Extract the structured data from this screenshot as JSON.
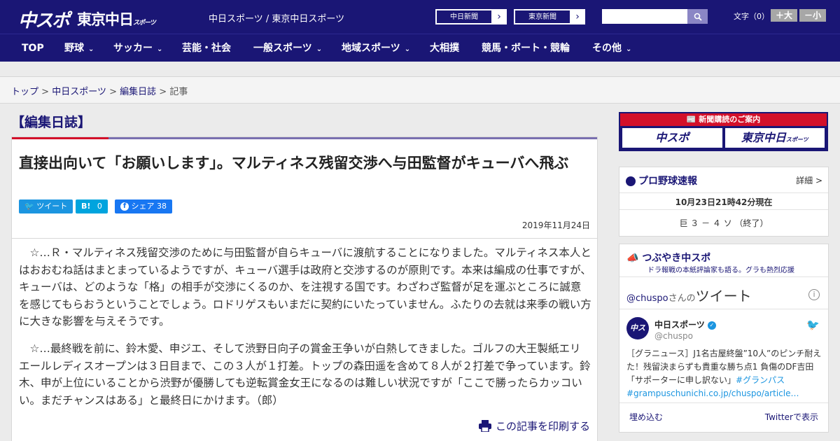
{
  "header": {
    "logo_chuspo": "中スポ",
    "logo_tokyo": "東京中日",
    "logo_tokyo_sub": "スポーツ",
    "site_title": "中日スポーツ / 東京中日スポーツ",
    "links": [
      {
        "label": "中日新聞",
        "arrow": "›"
      },
      {
        "label": "東京新聞",
        "arrow": "›"
      }
    ],
    "search_placeholder": "",
    "font_label": "文字（0）",
    "font_bigger": "＋大",
    "font_smaller": "－小"
  },
  "nav": {
    "items": [
      {
        "label": "TOP",
        "chevron": ""
      },
      {
        "label": "野球",
        "chevron": "⌄"
      },
      {
        "label": "サッカー",
        "chevron": "⌄"
      },
      {
        "label": "芸能・社会",
        "chevron": ""
      },
      {
        "label": "一般スポーツ",
        "chevron": "⌄"
      },
      {
        "label": "地域スポーツ",
        "chevron": "⌄"
      },
      {
        "label": "大相撲",
        "chevron": ""
      },
      {
        "label": "競馬・ボート・競輪",
        "chevron": ""
      },
      {
        "label": "その他",
        "chevron": "⌄"
      }
    ]
  },
  "breadcrumb": {
    "items": [
      "トップ",
      "中日スポーツ",
      "編集日誌"
    ],
    "separator": ">",
    "current": "記事"
  },
  "article": {
    "section": "【編集日誌】",
    "headline": "直接出向いて「お願いします」。マルティネス残留交渉へ与田監督がキューバへ飛ぶ",
    "share": {
      "tweet": "ツイート",
      "hatena": "B!",
      "hatena_count": "0",
      "facebook": "シェア",
      "facebook_count": "38"
    },
    "date": "2019年11月24日",
    "paragraphs": [
      "☆…Ｒ・マルティネス残留交渉のために与田監督が自らキューバに渡航することになりました。マルティネス本人とはおおむね話はまとまっているようですが、キューバ選手は政府と交渉するのが原則です。本来は編成の仕事ですが、キューバは、どのような「格」の相手が交渉にくるのか、を注視する国です。わざわざ監督が足を運ぶところに誠意を感じてもらおうということでしょう。ロドリゲスもいまだに契約にいたっていません。ふたりの去就は来季の戦い方に大きな影響を与えそうです。",
      "☆…最終戦を前に、鈴木愛、申ジエ、そして渋野日向子の賞金王争いが白熱してきました。ゴルフの大王製紙エリエールレディスオープンは３日目まで、この３人が１打差。トップの森田遥を含めて８人が２打差で争っています。鈴木、申が上位にいることから渋野が優勝しても逆転賞金女王になるのは難しい状況ですが「ここで勝ったらカッコいい。まだチャンスはある」と最終日にかけます。（郎）"
    ],
    "print_label": "この記事を印刷する"
  },
  "sidebar": {
    "subscribe": {
      "title": "新聞購読のご案内",
      "logo1": "中スポ",
      "logo2": "東京中日",
      "logo2_sub": "スポーツ"
    },
    "baseball": {
      "title": "プロ野球速報",
      "more": "詳細 >",
      "updated": "10月23日21時42分現在",
      "score": "巨 ３ － ４ ソ （終了）"
    },
    "tweets": {
      "title": "つぶやき中スポ",
      "subtitle": "ドラ報戦の本紙評論家も語る。グラも熱烈応援",
      "handle_prefix": "@chuspo",
      "handle_suffix": "さんの",
      "header_label": "ツイート",
      "account_name": "中日スポーツ",
      "account_handle": "@chuspo",
      "tweet_text": "［グラニュース］J1名古屋終盤”10人”のピンチ耐えた！残留決まらずも貴重な勝ち点1 負傷のDF吉田「サポーターに申し訳ない」",
      "tweet_hashtag": "#グランパス",
      "tweet_link": "#grampuschunichi.co.jp/chuspo/article…",
      "embed_label": "埋め込む",
      "view_label": "Twitterで表示"
    }
  },
  "colors": {
    "brand": "#1a1675",
    "accent_red": "#d3102a",
    "twitter": "#1b95e0"
  }
}
